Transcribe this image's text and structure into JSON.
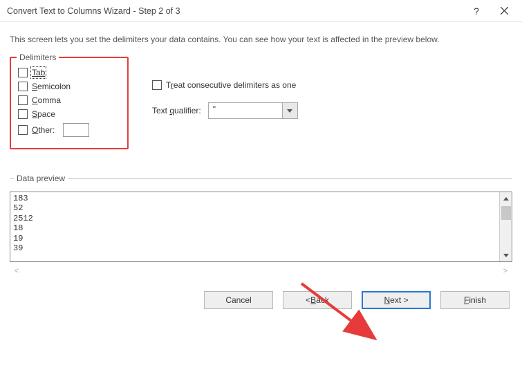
{
  "title": "Convert Text to Columns Wizard - Step 2 of 3",
  "intro": "This screen lets you set the delimiters your data contains.  You can see how your text is affected in the preview below.",
  "delimiters": {
    "group_label": "Delimiters",
    "tab": "Tab",
    "semicolon": "Semicolon",
    "comma": "Comma",
    "space": "Space",
    "other": "Other:"
  },
  "options": {
    "treat_consecutive": "Treat consecutive delimiters as one",
    "qualifier_label": "Text qualifier:",
    "qualifier_value": "\""
  },
  "preview": {
    "label": "Data preview",
    "rows_text": "183\n52\n2512\n18\n19\n39"
  },
  "buttons": {
    "cancel": "Cancel",
    "back": "< Back",
    "next": "Next >",
    "finish": "Finish"
  }
}
